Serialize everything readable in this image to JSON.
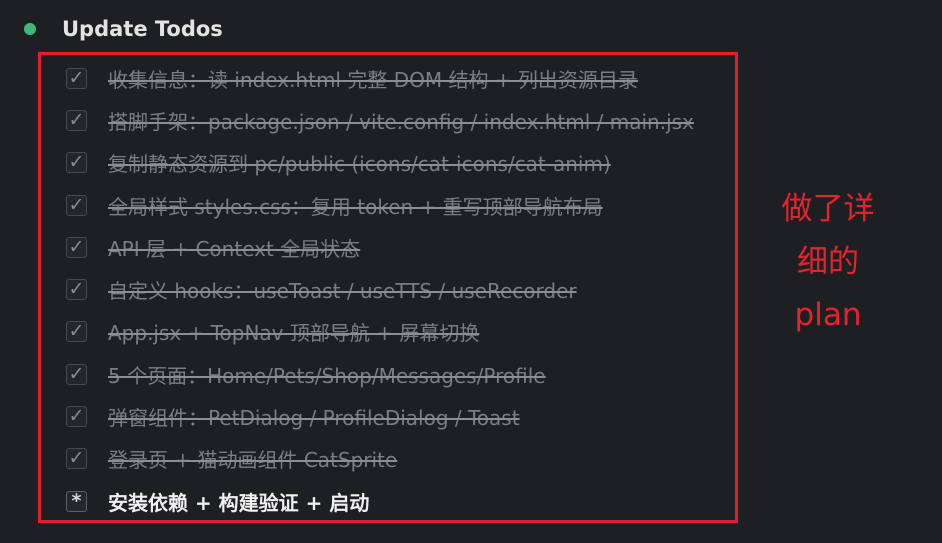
{
  "header": {
    "title": "Update Todos",
    "status_color": "#3fb87a"
  },
  "todos": [
    {
      "label": "收集信息：读 index.html 完整 DOM 结构 + 列出资源目录",
      "status": "completed",
      "icon": "check-icon"
    },
    {
      "label": "搭脚手架：package.json / vite.config / index.html / main.jsx",
      "status": "completed",
      "icon": "check-icon"
    },
    {
      "label": "复制静态资源到 pc/public (icons/cat-icons/cat-anim)",
      "status": "completed",
      "icon": "check-icon"
    },
    {
      "label": "全局样式 styles.css：复用 token + 重写顶部导航布局",
      "status": "completed",
      "icon": "check-icon"
    },
    {
      "label": "API 层 + Context 全局状态",
      "status": "completed",
      "icon": "check-icon"
    },
    {
      "label": "自定义 hooks：useToast / useTTS / useRecorder",
      "status": "completed",
      "icon": "check-icon"
    },
    {
      "label": "App.jsx + TopNav 顶部导航 + 屏幕切换",
      "status": "completed",
      "icon": "check-icon"
    },
    {
      "label": "5 个页面：Home/Pets/Shop/Messages/Profile",
      "status": "completed",
      "icon": "check-icon"
    },
    {
      "label": "弹窗组件：PetDialog / ProfileDialog / Toast",
      "status": "completed",
      "icon": "check-icon"
    },
    {
      "label": "登录页 + 猫动画组件 CatSprite",
      "status": "completed",
      "icon": "check-icon"
    },
    {
      "label": "安装依赖 + 构建验证 + 启动",
      "status": "in_progress",
      "icon": "asterisk-icon"
    }
  ],
  "check_glyph": "✓",
  "progress_glyph": "*",
  "annotation": {
    "lines": [
      "做了详",
      "细的",
      "plan"
    ],
    "color": "#e3232d"
  }
}
